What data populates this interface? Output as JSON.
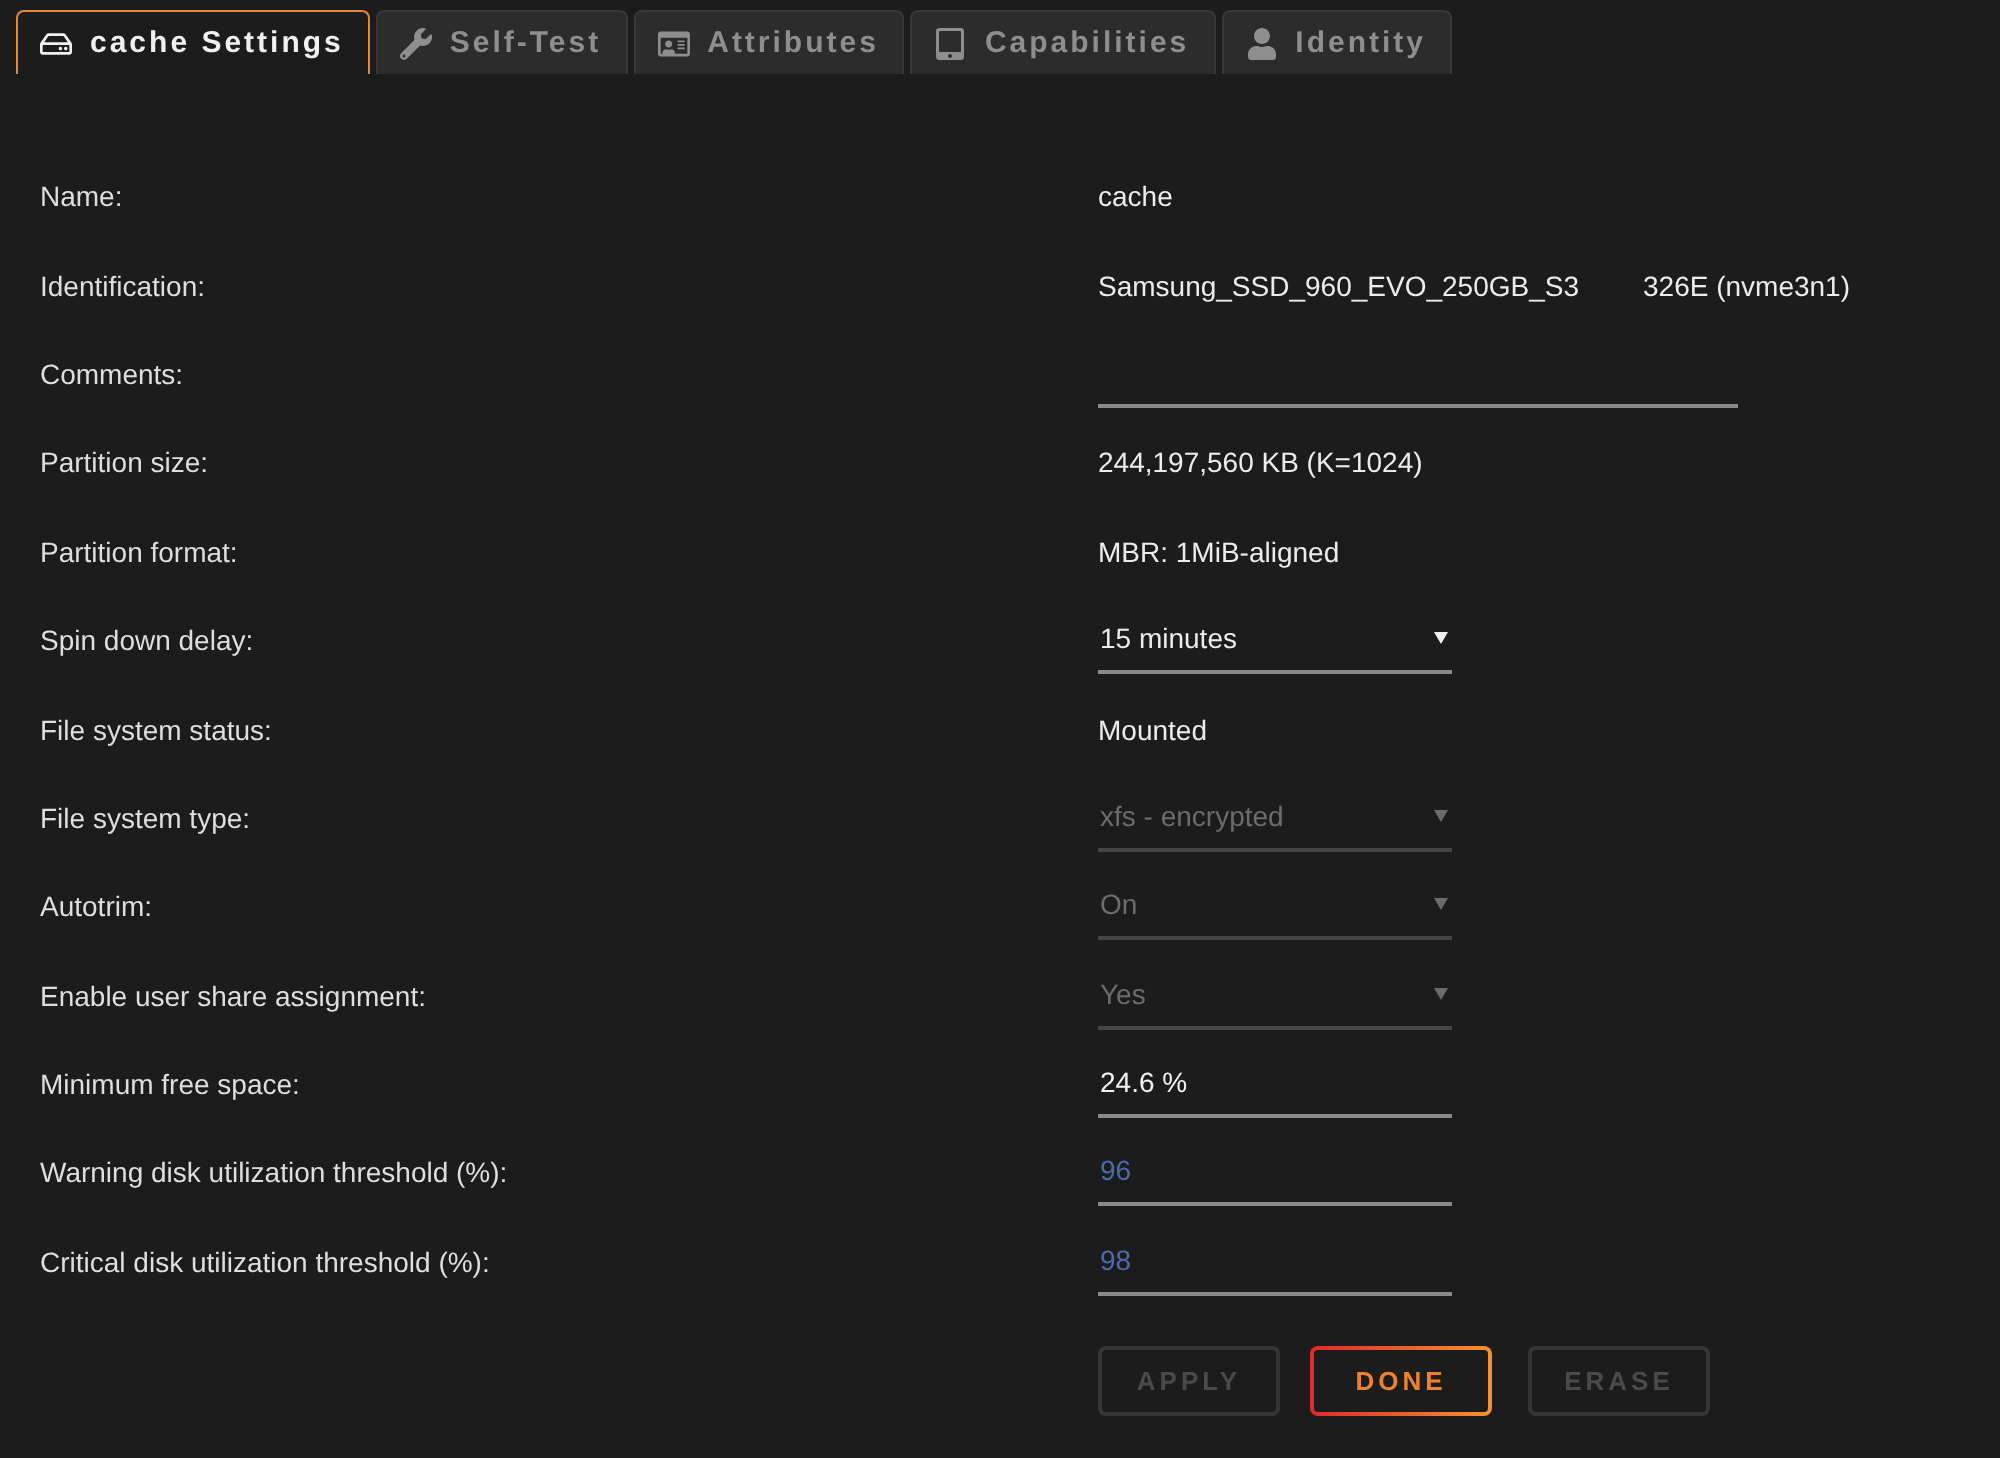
{
  "tabs": [
    {
      "label": "cache Settings",
      "selected": true
    },
    {
      "label": "Self-Test",
      "selected": false
    },
    {
      "label": "Attributes",
      "selected": false
    },
    {
      "label": "Capabilities",
      "selected": false
    },
    {
      "label": "Identity",
      "selected": false
    }
  ],
  "settings": {
    "rows": [
      {
        "kind": "text",
        "label": "Name:",
        "value": "cache"
      },
      {
        "kind": "split",
        "label": "Identification:",
        "value": "Samsung_SSD_960_EVO_250GB_S3",
        "value_end": "326E (nvme3n1)"
      },
      {
        "kind": "comment",
        "label": "Comments:"
      },
      {
        "kind": "text",
        "label": "Partition size:",
        "value": "244,197,560 KB (K=1024)"
      },
      {
        "kind": "text",
        "label": "Partition format:",
        "value": "MBR: 1MiB-aligned"
      },
      {
        "kind": "select",
        "label": "Spin down delay:",
        "value": "15 minutes",
        "disabled": false
      },
      {
        "kind": "text",
        "label": "File system status:",
        "value": "Mounted"
      },
      {
        "kind": "select",
        "label": "File system type:",
        "value": "xfs - encrypted",
        "disabled": true
      },
      {
        "kind": "select",
        "label": "Autotrim:",
        "value": "On",
        "disabled": true
      },
      {
        "kind": "select",
        "label": "Enable user share assignment:",
        "value": "Yes",
        "disabled": true
      },
      {
        "kind": "input",
        "label": "Minimum free space:",
        "value": "24.6 %"
      },
      {
        "kind": "input",
        "label": "Warning disk utilization threshold (%):",
        "placeholder": "96"
      },
      {
        "kind": "input",
        "label": "Critical disk utilization threshold (%):",
        "placeholder": "98"
      }
    ]
  },
  "buttons": [
    {
      "label": "APPLY",
      "disabled": true
    },
    {
      "label": "DONE",
      "disabled": false
    },
    {
      "label": "ERASE",
      "disabled": true
    }
  ]
}
